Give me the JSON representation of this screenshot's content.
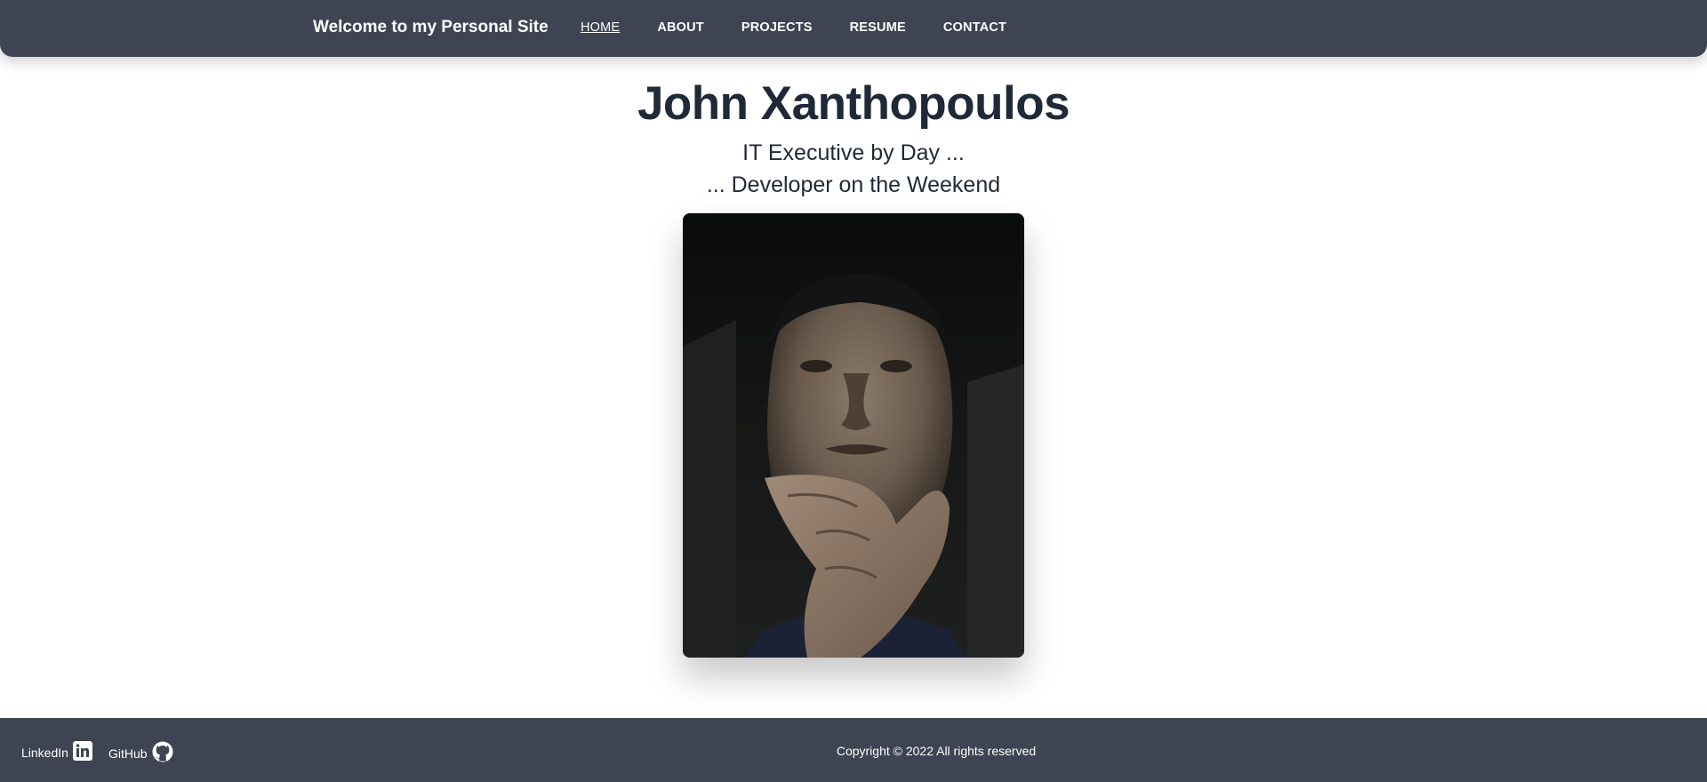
{
  "header": {
    "brand": "Welcome to my Personal Site",
    "nav": [
      {
        "label": "HOME",
        "active": true
      },
      {
        "label": "ABOUT",
        "active": false
      },
      {
        "label": "PROJECTS",
        "active": false
      },
      {
        "label": "RESUME",
        "active": false
      },
      {
        "label": "CONTACT",
        "active": false
      }
    ]
  },
  "hero": {
    "name": "John Xanthopoulos",
    "tagline_1": "IT Executive by Day ...",
    "tagline_2": "... Developer on the Weekend",
    "photo_icon": "portrait-photo"
  },
  "footer": {
    "linkedin_label": "LinkedIn",
    "linkedin_icon": "linkedin-icon",
    "github_label": "GitHub",
    "github_icon": "github-icon",
    "copyright": "Copyright © 2022 All rights reserved"
  },
  "colors": {
    "bar": "#3e4451",
    "text_dark": "#1f2937",
    "text_light": "#ffffff"
  }
}
